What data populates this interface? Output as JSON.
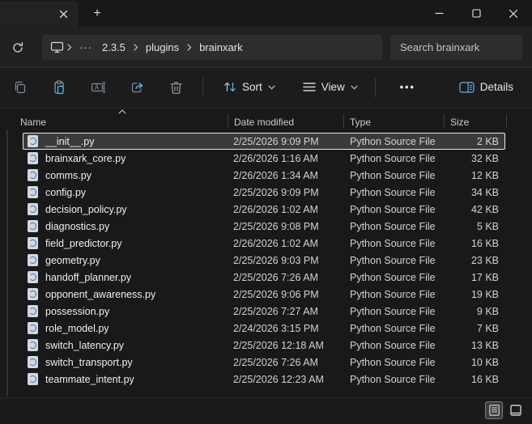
{
  "window": {
    "tab_title": "",
    "new_tab_glyph": "+"
  },
  "address_bar": {
    "overflow_glyph": "···",
    "crumbs": [
      "2.3.5",
      "plugins",
      "brainxark"
    ],
    "search_placeholder": "Search brainxark"
  },
  "toolbar": {
    "sort_label": "Sort",
    "view_label": "View",
    "more_glyph": "•••",
    "details_label": "Details"
  },
  "columns": {
    "name": "Name",
    "modified": "Date modified",
    "type": "Type",
    "size": "Size"
  },
  "files": [
    {
      "name": "__init__.py",
      "modified": "2/25/2026 9:09 PM",
      "type": "Python Source File",
      "size": "2 KB",
      "selected": true
    },
    {
      "name": "brainxark_core.py",
      "modified": "2/26/2026 1:16 AM",
      "type": "Python Source File",
      "size": "32 KB"
    },
    {
      "name": "comms.py",
      "modified": "2/26/2026 1:34 AM",
      "type": "Python Source File",
      "size": "12 KB"
    },
    {
      "name": "config.py",
      "modified": "2/25/2026 9:09 PM",
      "type": "Python Source File",
      "size": "34 KB"
    },
    {
      "name": "decision_policy.py",
      "modified": "2/26/2026 1:02 AM",
      "type": "Python Source File",
      "size": "42 KB"
    },
    {
      "name": "diagnostics.py",
      "modified": "2/25/2026 9:08 PM",
      "type": "Python Source File",
      "size": "5 KB"
    },
    {
      "name": "field_predictor.py",
      "modified": "2/26/2026 1:02 AM",
      "type": "Python Source File",
      "size": "16 KB"
    },
    {
      "name": "geometry.py",
      "modified": "2/25/2026 9:03 PM",
      "type": "Python Source File",
      "size": "23 KB"
    },
    {
      "name": "handoff_planner.py",
      "modified": "2/25/2026 7:26 AM",
      "type": "Python Source File",
      "size": "17 KB"
    },
    {
      "name": "opponent_awareness.py",
      "modified": "2/25/2026 9:06 PM",
      "type": "Python Source File",
      "size": "19 KB"
    },
    {
      "name": "possession.py",
      "modified": "2/25/2026 7:27 AM",
      "type": "Python Source File",
      "size": "9 KB"
    },
    {
      "name": "role_model.py",
      "modified": "2/24/2026 3:15 PM",
      "type": "Python Source File",
      "size": "7 KB"
    },
    {
      "name": "switch_latency.py",
      "modified": "2/25/2026 12:18 AM",
      "type": "Python Source File",
      "size": "13 KB"
    },
    {
      "name": "switch_transport.py",
      "modified": "2/25/2026 7:26 AM",
      "type": "Python Source File",
      "size": "10 KB"
    },
    {
      "name": "teammate_intent.py",
      "modified": "2/25/2026 12:23 AM",
      "type": "Python Source File",
      "size": "16 KB"
    }
  ],
  "colors": {
    "accent_blue": "#4cc2ff",
    "python_icon_blue": "#2f72c4",
    "selection_bg": "#3a3a3a",
    "selection_outline": "#e9e9e9"
  }
}
